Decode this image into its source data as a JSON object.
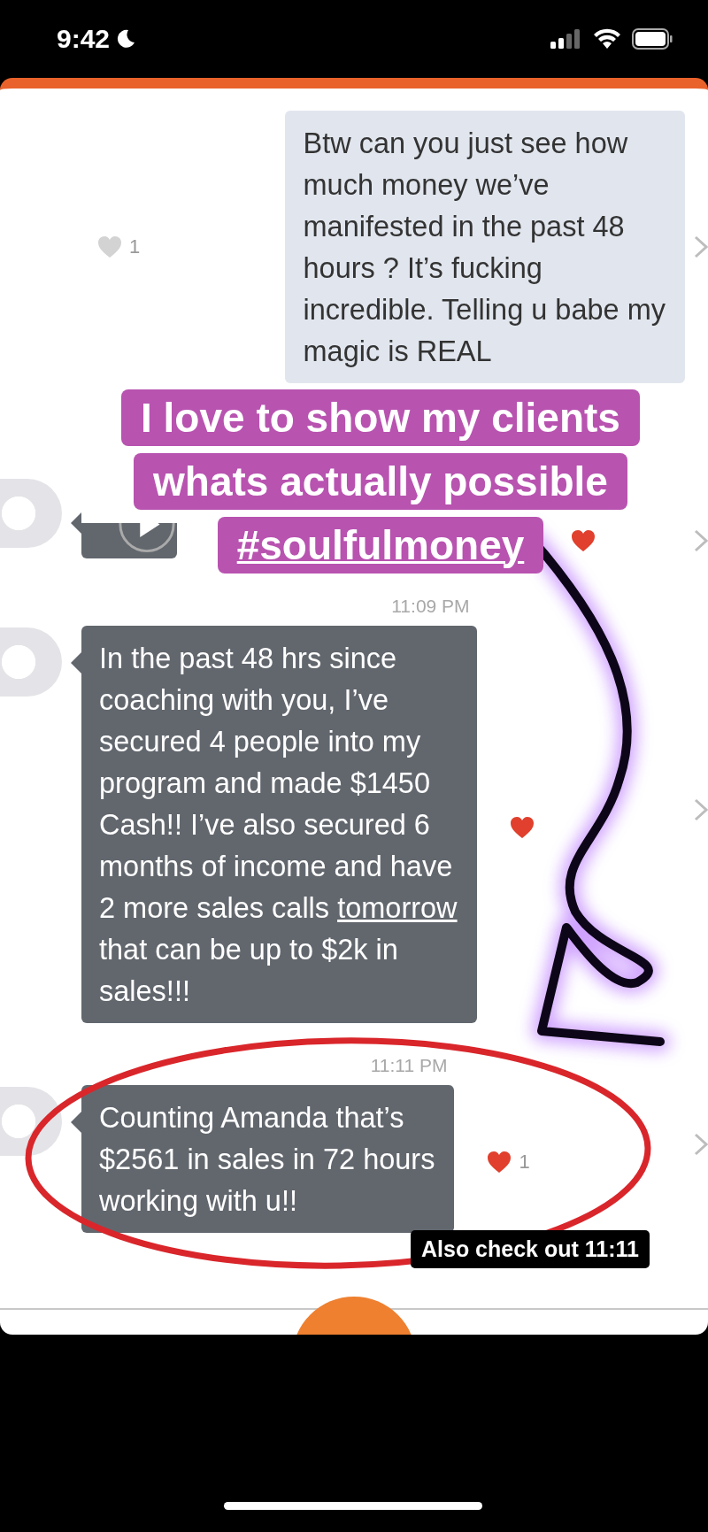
{
  "status_bar": {
    "time": "9:42"
  },
  "messages": [
    {
      "kind": "sent",
      "segments": [
        {
          "text": "Btw can you just see how\nmuch money we’ve\nmanifested in the past 48\nhours ? It’s fucking\nincredible. Telling u babe my\nmagic is REAL",
          "underline": false
        }
      ],
      "liked": false,
      "likes": "1"
    },
    {
      "kind": "video",
      "liked": true
    },
    {
      "kind": "received",
      "timestamp": "11:09 PM",
      "segments": [
        {
          "text": "In the past 48 hrs since\ncoaching with you, I’ve\nsecured 4 people into my\nprogram and made $1450\nCash!! I’ve also secured 6\nmonths of income and have\n2 more sales calls ",
          "underline": false
        },
        {
          "text": "tomorrow",
          "underline": true
        },
        {
          "text": "\nthat can be up to $2k in\nsales!!!",
          "underline": false
        }
      ],
      "liked": true
    },
    {
      "kind": "received",
      "timestamp": "11:11 PM",
      "segments": [
        {
          "text": "Counting  Amanda that’s\n$2561 in sales in 72 hours\nworking with u!!",
          "underline": false
        }
      ],
      "liked": true,
      "likes": "1"
    }
  ],
  "sticker": {
    "lines": [
      {
        "text": "I love to show my clients",
        "underline": false
      },
      {
        "text": "whats actually possible",
        "underline": false
      },
      {
        "text": "#soulfulmoney",
        "underline": true
      }
    ]
  },
  "caption": "Also check out 11:11"
}
